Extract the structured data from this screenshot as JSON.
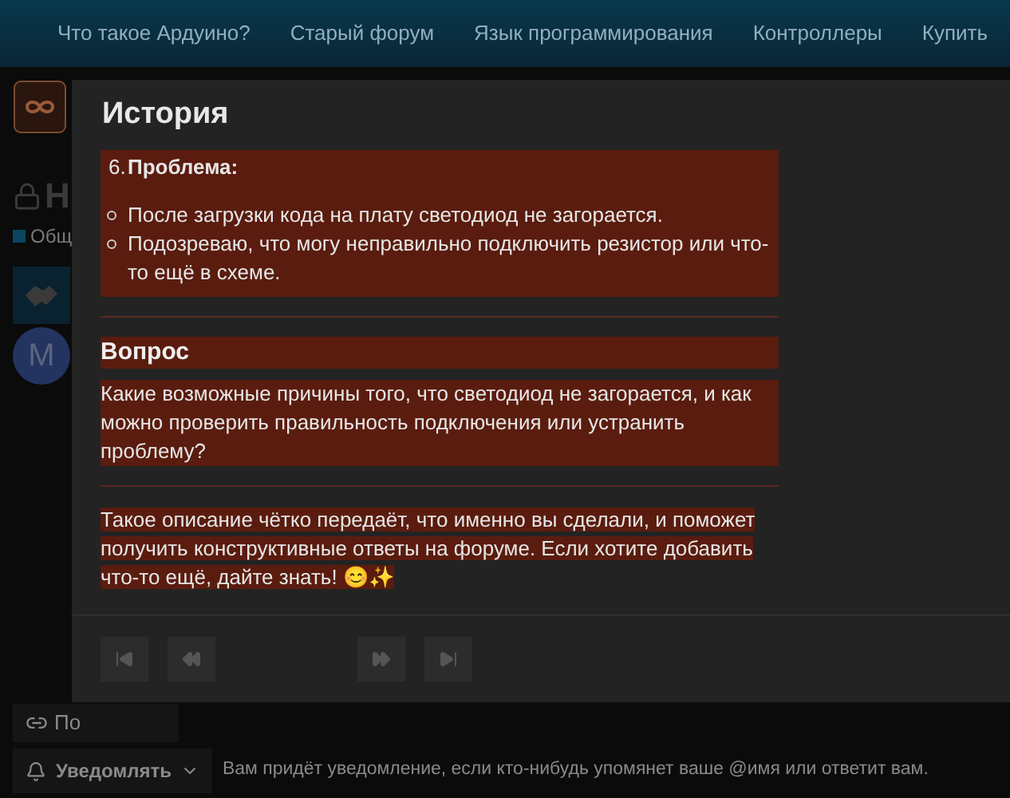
{
  "nav": {
    "items": [
      "Что такое Ардуино?",
      "Старый форум",
      "Язык программирования",
      "Контроллеры",
      "Купить"
    ]
  },
  "topic": {
    "title": "Н",
    "category": "Общ",
    "avatar_letter": "M"
  },
  "bottom": {
    "share_button": "По",
    "notify_button": "Уведомлять",
    "notify_text": "Вам придёт уведомление, если кто-нибудь упомянет ваше @имя или ответит вам."
  },
  "modal": {
    "title": "История",
    "item": {
      "number": "6.",
      "title": "Проблема:",
      "bullets": [
        "После загрузки кода на плату светодиод не загорается.",
        "Подозреваю, что могу неправильно подключить резистор или что-то ещё в схеме."
      ]
    },
    "heading": "Вопрос",
    "question": "Какие возможные причины того, что светодиод не загорается, и как можно проверить правильность подключения или устранить проблему?",
    "closing": "Такое описание чётко передаёт, что именно вы сделали, и поможет получить конструктивные ответы на форуме. Если хотите добавить что-то ещё, дайте знать! 😊✨"
  }
}
